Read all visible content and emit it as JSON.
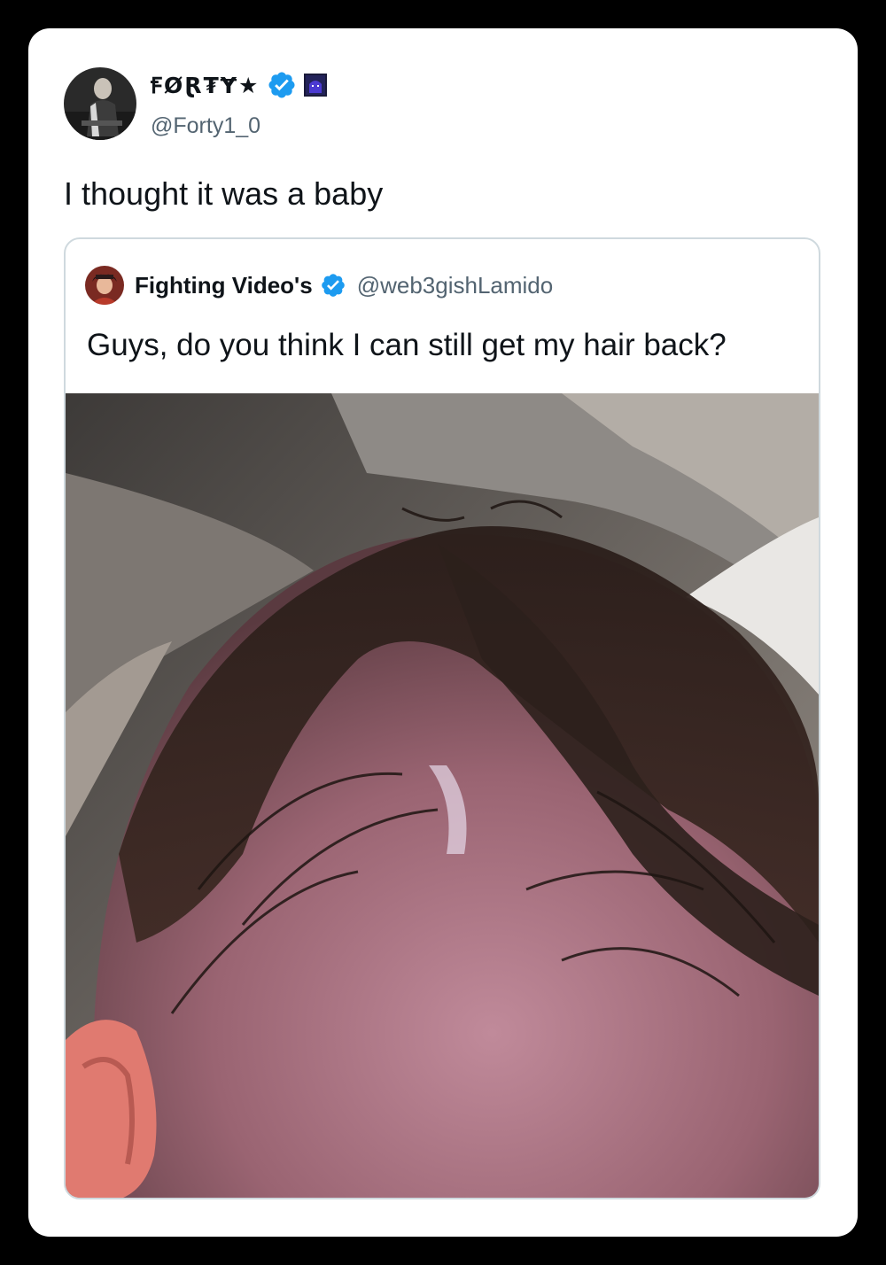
{
  "tweet": {
    "author": {
      "display_name": "ꞘØⱤ₮Ɏ★",
      "handle": "@Forty1_0",
      "verified": true,
      "avatar_icon": "user-avatar-icon",
      "badge_icon": "purple-ghost-icon"
    },
    "text": "I thought it was a baby"
  },
  "quoted_tweet": {
    "author": {
      "display_name": "Fighting Video's",
      "handle": "@web3gishLamido",
      "verified": true,
      "avatar_icon": "user-avatar-icon"
    },
    "text": "Guys, do you think I can still get my hair back?",
    "media": {
      "type": "photo",
      "alt": "close-up of a baby's head with thin dark hair"
    }
  },
  "colors": {
    "background": "#000000",
    "card": "#ffffff",
    "text_primary": "#0f1419",
    "text_secondary": "#536471",
    "border": "#cfd9de",
    "verified_blue": "#1d9bf0"
  }
}
